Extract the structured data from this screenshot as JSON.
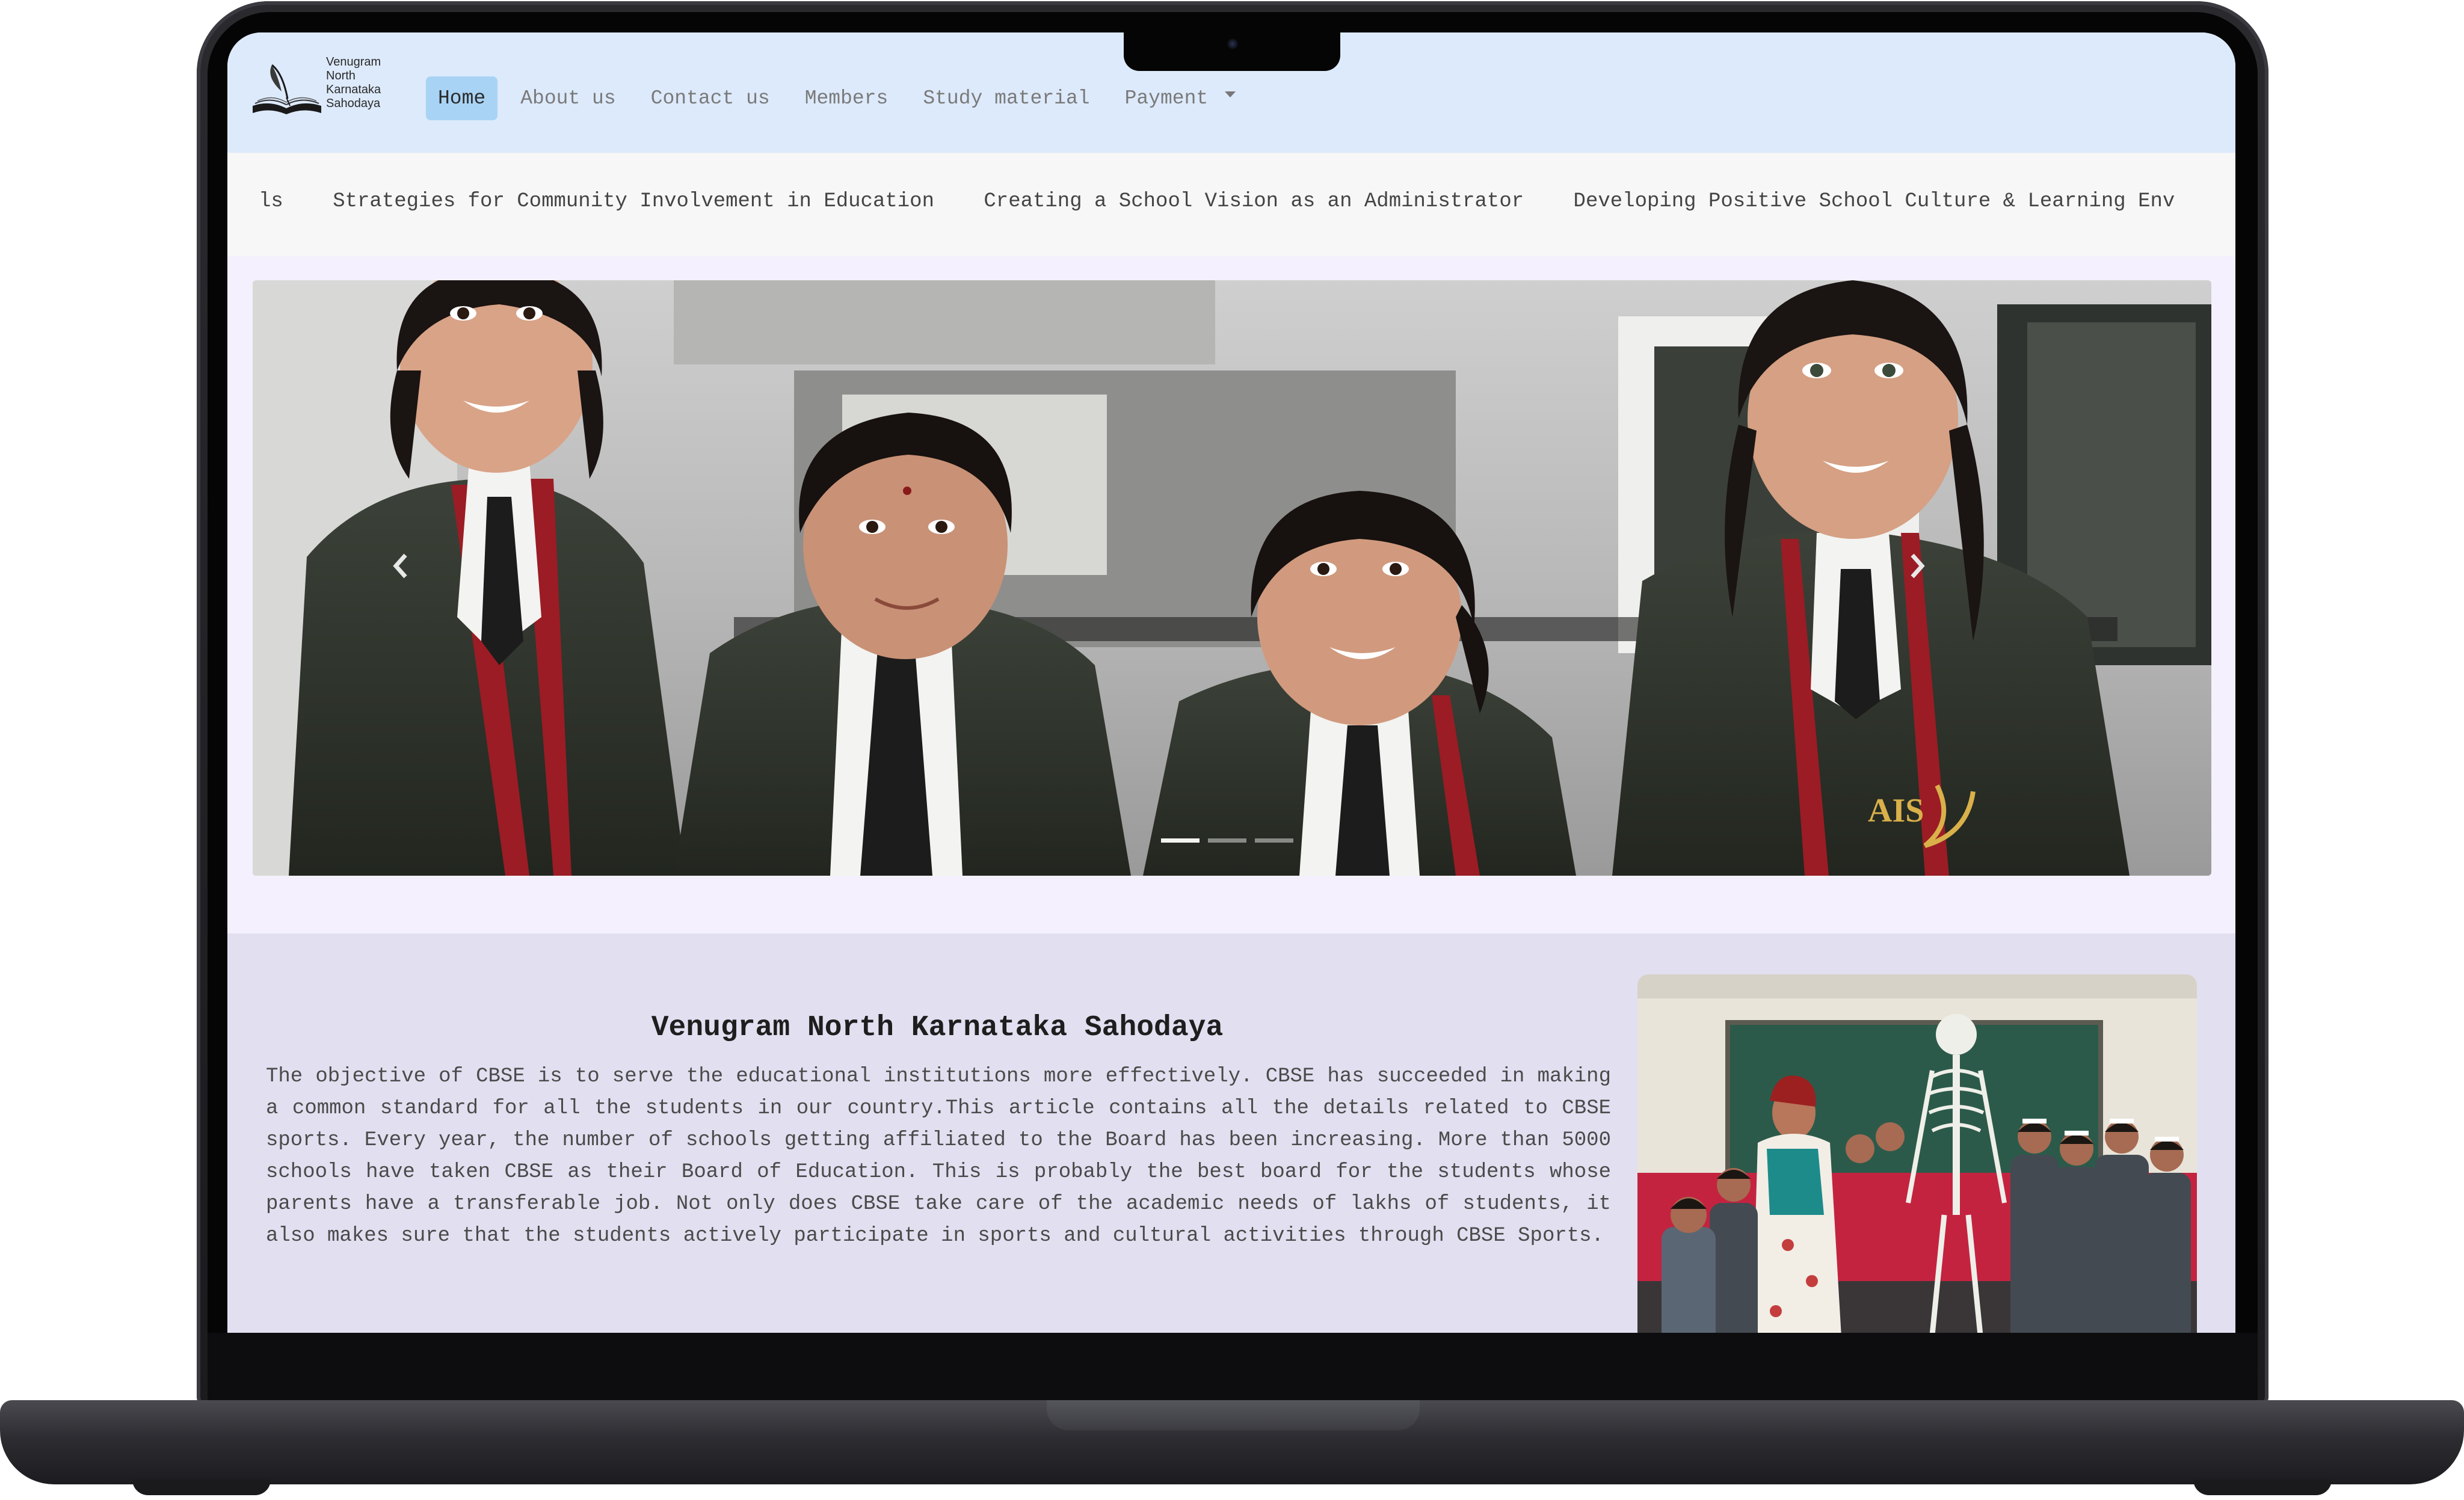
{
  "site": {
    "logo": {
      "lines": "Venugram\nNorth\nKarnataka\nSahodaya"
    },
    "nav": {
      "home": "Home",
      "about": "About us",
      "contact": "Contact us",
      "members": "Members",
      "study": "Study material",
      "payment": "Payment"
    },
    "marquee": [
      "ls",
      "Strategies for Community Involvement in Education",
      "Creating a School Vision as an Administrator",
      "Developing Positive School Culture & Learning Env"
    ],
    "carousel": {
      "slides": 3,
      "active": 1
    },
    "about": {
      "title": "Venugram North Karnataka Sahodaya",
      "body": "The objective of CBSE is to serve the educational institutions more effectively. CBSE has succeeded in making a common standard for all the students in our country.This article contains all the details related to CBSE sports. Every year, the number of schools getting affiliated to the Board has been increasing. More than 5000 schools have taken CBSE as their Board of Education. This is probably the best board for the students whose parents have a transferable job. Not only does CBSE take care of the academic needs of lakhs of students, it also makes sure that the students actively participate in sports and cultural activities through CBSE Sports."
    }
  },
  "icons": {
    "prev": "chevron-left-icon",
    "next": "chevron-right-icon",
    "dropdown": "caret-down-icon",
    "logo": "open-book-quill-icon"
  },
  "colors": {
    "navbar_bg": "#ddeafb",
    "active_nav": "#a8d3f5",
    "about_bg": "#e2dff0",
    "carousel_bg": "#f4f0fd",
    "laptop_body": "#1b1b1e"
  }
}
